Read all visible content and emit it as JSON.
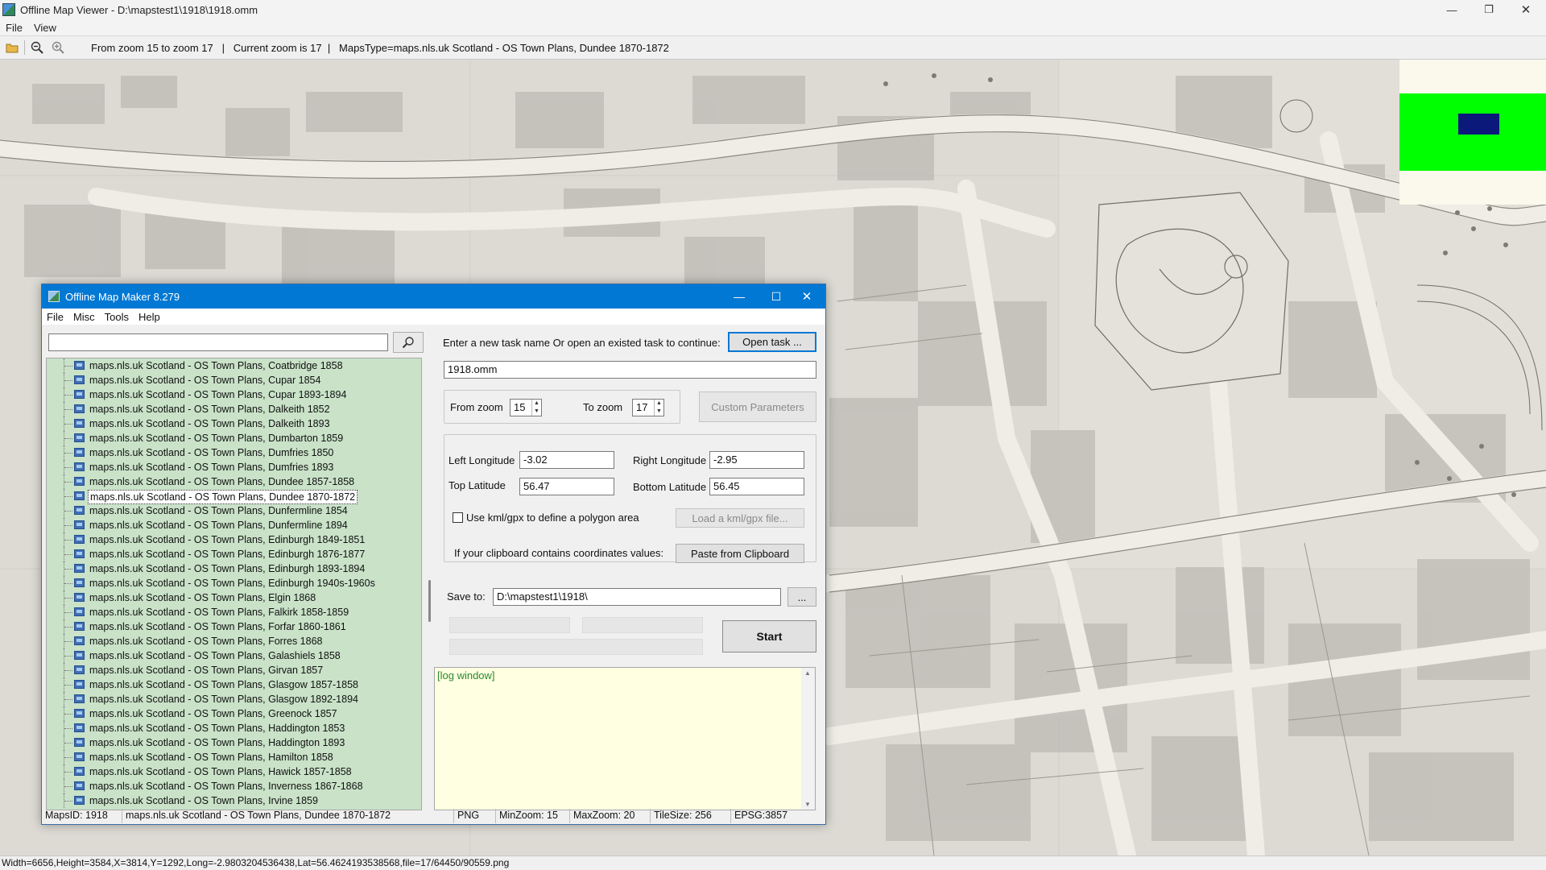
{
  "window": {
    "title": "Offline Map Viewer - D:\\mapstest1\\1918\\1918.omm",
    "menu": [
      "File",
      "View"
    ]
  },
  "toolbar": {
    "info": "From zoom 15 to zoom 17   |   Current zoom is 17  |   MapsType=maps.nls.uk Scotland - OS Town Plans, Dundee 1870-1872"
  },
  "status": {
    "text": "Width=6656,Height=3584,X=3814,Y=1292,Long=-2.9803204536438,Lat=56.4624193538568,file=17/64450/90559.png"
  },
  "map": {
    "colors": {
      "paper": "#dcdad3",
      "overview_green": "#00ff00",
      "overview_rect": "#0b1a7a"
    }
  },
  "dialog": {
    "title": "Offline Map Maker 8.279",
    "menu": [
      "File",
      "Misc",
      "Tools",
      "Help"
    ],
    "search": {
      "value": ""
    },
    "tree_items": [
      "maps.nls.uk Scotland - OS Town Plans, Coatbridge 1858",
      "maps.nls.uk Scotland - OS Town Plans, Cupar 1854",
      "maps.nls.uk Scotland - OS Town Plans, Cupar 1893-1894",
      "maps.nls.uk Scotland - OS Town Plans, Dalkeith 1852",
      "maps.nls.uk Scotland - OS Town Plans, Dalkeith 1893",
      "maps.nls.uk Scotland - OS Town Plans, Dumbarton 1859",
      "maps.nls.uk Scotland - OS Town Plans, Dumfries 1850",
      "maps.nls.uk Scotland - OS Town Plans, Dumfries 1893",
      "maps.nls.uk Scotland - OS Town Plans, Dundee 1857-1858",
      "maps.nls.uk Scotland - OS Town Plans, Dundee 1870-1872",
      "maps.nls.uk Scotland - OS Town Plans, Dunfermline 1854",
      "maps.nls.uk Scotland - OS Town Plans, Dunfermline 1894",
      "maps.nls.uk Scotland - OS Town Plans, Edinburgh 1849-1851",
      "maps.nls.uk Scotland - OS Town Plans, Edinburgh 1876-1877",
      "maps.nls.uk Scotland - OS Town Plans, Edinburgh 1893-1894",
      "maps.nls.uk Scotland - OS Town Plans, Edinburgh 1940s-1960s",
      "maps.nls.uk Scotland - OS Town Plans, Elgin 1868",
      "maps.nls.uk Scotland - OS Town Plans, Falkirk 1858-1859",
      "maps.nls.uk Scotland - OS Town Plans, Forfar 1860-1861",
      "maps.nls.uk Scotland - OS Town Plans, Forres 1868",
      "maps.nls.uk Scotland - OS Town Plans, Galashiels 1858",
      "maps.nls.uk Scotland - OS Town Plans, Girvan 1857",
      "maps.nls.uk Scotland - OS Town Plans, Glasgow 1857-1858",
      "maps.nls.uk Scotland - OS Town Plans, Glasgow 1892-1894",
      "maps.nls.uk Scotland - OS Town Plans, Greenock 1857",
      "maps.nls.uk Scotland - OS Town Plans, Haddington 1853",
      "maps.nls.uk Scotland - OS Town Plans, Haddington 1893",
      "maps.nls.uk Scotland - OS Town Plans, Hamilton 1858",
      "maps.nls.uk Scotland - OS Town Plans, Hawick 1857-1858",
      "maps.nls.uk Scotland - OS Town Plans, Inverness 1867-1868",
      "maps.nls.uk Scotland - OS Town Plans, Irvine 1859"
    ],
    "selected_item": "maps.nls.uk Scotland - OS Town Plans, Dundee 1870-1872",
    "task_prompt": "Enter a new task name Or open an existed task to continue:",
    "open_task_label": "Open task ...",
    "task_name": "1918.omm",
    "from_zoom_label": "From zoom",
    "from_zoom": "15",
    "to_zoom_label": "To zoom",
    "to_zoom": "17",
    "custom_params_label": "Custom Parameters",
    "left_lon_label": "Left Longitude",
    "left_lon": "-3.02",
    "right_lon_label": "Right Longitude",
    "right_lon": "-2.95",
    "top_lat_label": "Top Latitude",
    "top_lat": "56.47",
    "bottom_lat_label": "Bottom Latitude",
    "bottom_lat": "56.45",
    "kml_checkbox_label": "Use kml/gpx to define a polygon area",
    "kml_checked": false,
    "load_kml_label": "Load a kml/gpx file...",
    "clipboard_label": "If your clipboard contains coordinates values:",
    "paste_label": "Paste from Clipboard",
    "save_to_label": "Save to:",
    "save_path": "D:\\mapstest1\\1918\\",
    "browse_label": "...",
    "start_label": "Start",
    "log_text": "[log window]",
    "statusbar": {
      "maps_id": "MapsID: 1918",
      "map_name": "maps.nls.uk Scotland - OS Town Plans, Dundee 1870-1872",
      "format": "PNG",
      "min_zoom": "MinZoom: 15",
      "max_zoom": "MaxZoom: 20",
      "tile_size": "TileSize: 256",
      "epsg": "EPSG:3857"
    }
  }
}
